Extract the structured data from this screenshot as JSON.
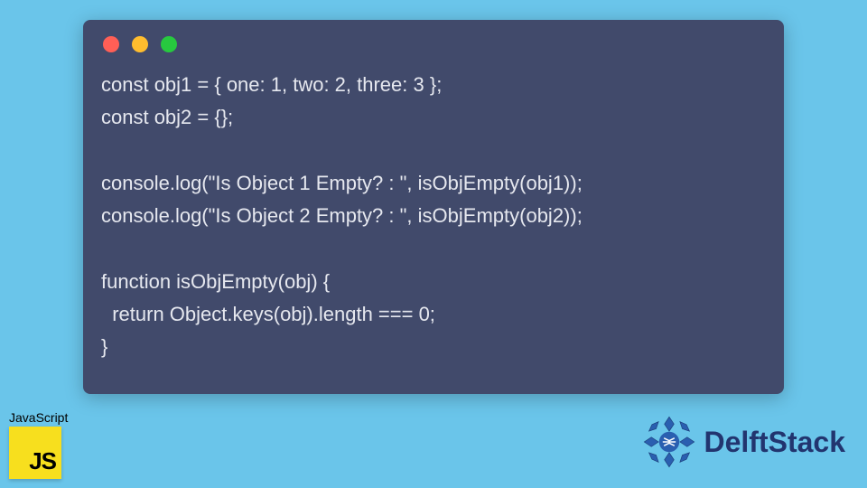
{
  "window": {
    "traffic_lights": [
      "red",
      "yellow",
      "green"
    ]
  },
  "code": {
    "lines": [
      "const obj1 = { one: 1, two: 2, three: 3 };",
      "const obj2 = {};",
      "",
      "console.log(\"Is Object 1 Empty? : \", isObjEmpty(obj1));",
      "console.log(\"Is Object 2 Empty? : \", isObjEmpty(obj2));",
      "",
      "function isObjEmpty(obj) {",
      "  return Object.keys(obj).length === 0;",
      "}"
    ]
  },
  "js_badge": {
    "label": "JavaScript",
    "icon_text": "JS"
  },
  "brand": {
    "name": "DelftStack"
  },
  "colors": {
    "page_bg": "#6ac5ea",
    "window_bg": "#414a6b",
    "code_text": "#e6e8ef",
    "js_bg": "#f7df1e",
    "brand_color": "#22356f"
  }
}
